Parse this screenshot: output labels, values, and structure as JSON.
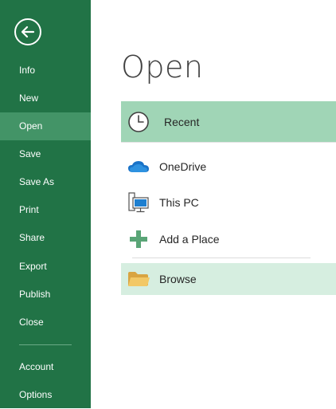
{
  "nav": {
    "back_icon": "back-arrow-icon",
    "items": [
      {
        "label": "Info"
      },
      {
        "label": "New"
      },
      {
        "label": "Open"
      },
      {
        "label": "Save"
      },
      {
        "label": "Save As"
      },
      {
        "label": "Print"
      },
      {
        "label": "Share"
      },
      {
        "label": "Export"
      },
      {
        "label": "Publish"
      },
      {
        "label": "Close"
      },
      {
        "label": "Account"
      },
      {
        "label": "Options"
      }
    ],
    "selected": "Open"
  },
  "main": {
    "title": "Open",
    "places": [
      {
        "label": "Recent",
        "icon": "clock-icon"
      },
      {
        "label": "OneDrive",
        "icon": "cloud-icon"
      },
      {
        "label": "This PC",
        "icon": "computer-icon"
      },
      {
        "label": "Add a Place",
        "icon": "plus-icon"
      },
      {
        "label": "Browse",
        "icon": "folder-icon"
      }
    ]
  },
  "colors": {
    "sidebar": "#217346",
    "sidebar_selected": "#439467",
    "recent_highlight": "#a0d5b6",
    "browse_highlight": "#d6eee0"
  }
}
